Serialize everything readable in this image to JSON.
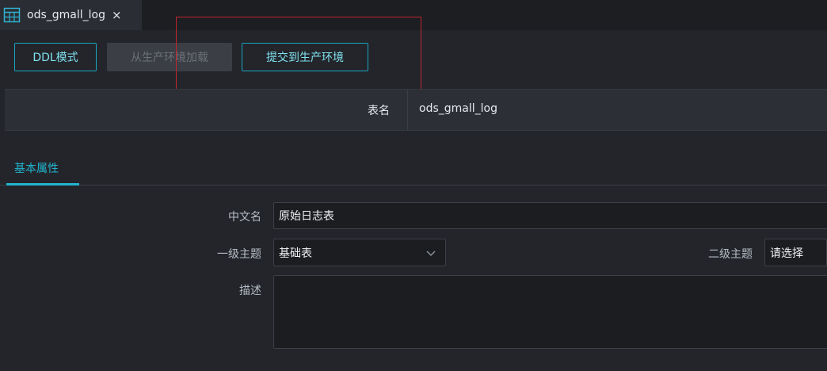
{
  "tab": {
    "title": "ods_gmall_log",
    "close": "×",
    "icon": "table-icon"
  },
  "toolbar": {
    "ddl_mode": "DDL模式",
    "load_from_prod": "从生产环境加载",
    "submit_to_prod": "提交到生产环境"
  },
  "table": {
    "label": "表名",
    "value": "ods_gmall_log"
  },
  "section_tabs": [
    {
      "label": "基本属性"
    }
  ],
  "form": {
    "chinese_name": {
      "label": "中文名",
      "value": "原始日志表"
    },
    "primary_topic": {
      "label": "一级主题",
      "value": "基础表"
    },
    "secondary_topic": {
      "label": "二级主题",
      "value": "请选择"
    },
    "description": {
      "label": "描述",
      "value": ""
    }
  },
  "colors": {
    "accent": "#22b5cf",
    "highlight": "#c0262b",
    "background": "#23252b"
  }
}
